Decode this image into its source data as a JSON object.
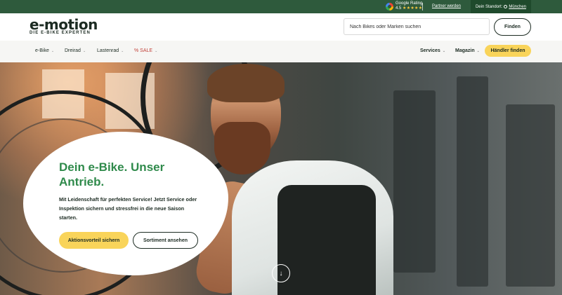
{
  "topbar": {
    "google_label": "Google Rating",
    "google_score": "4.5",
    "google_stars": "★★★★★",
    "partner_label": "Partner werden",
    "standort_label": "Dein Standort:",
    "standort_city": "München"
  },
  "header": {
    "logo_word": "e-motion",
    "logo_tagline": "DIE E-BIKE EXPERTEN",
    "search_placeholder": "Nach Bikes oder Marken suchen",
    "find_label": "Finden"
  },
  "nav": {
    "left_items": [
      {
        "label": "e-Bike"
      },
      {
        "label": "Dreirad"
      },
      {
        "label": "Lastenrad"
      },
      {
        "label": "% SALE"
      }
    ],
    "right_items": [
      {
        "label": "Services"
      },
      {
        "label": "Magazin"
      }
    ],
    "dealer_label": "Händler finden",
    "chevron": "⌄"
  },
  "hero": {
    "title": "Dein e-Bike. Unser Antrieb.",
    "text": "Mit Leidenschaft für perfekten Service! Jetzt Service oder Inspektion sichern und stressfrei in die neue Saison starten.",
    "primary_cta": "Aktionsvorteil sichern",
    "secondary_cta": "Sortiment ansehen",
    "scroll_icon": "↓"
  },
  "colors": {
    "brand_green": "#2f8a4b",
    "topbar_green": "#2e5a3c",
    "accent_yellow": "#f9d45a",
    "sale_red": "#c2433b"
  }
}
